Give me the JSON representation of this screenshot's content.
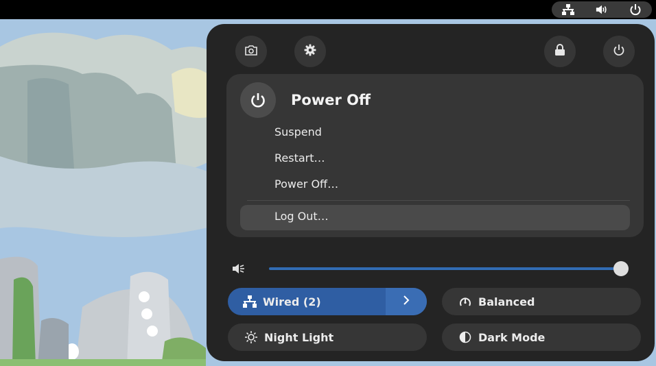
{
  "top_bar": {
    "indicators": [
      "network-wired-icon",
      "volume-icon",
      "power-icon"
    ]
  },
  "quick_settings": {
    "header_buttons": [
      "screenshot-icon",
      "settings-icon",
      "lock-icon",
      "power-icon"
    ],
    "power_menu": {
      "title": "Power Off",
      "items": [
        "Suspend",
        "Restart…",
        "Power Off…"
      ],
      "logout": "Log Out…"
    },
    "volume": {
      "level": 1.0
    },
    "toggles": {
      "wired": {
        "label": "Wired (2)",
        "active": true
      },
      "power_mode": {
        "label": "Balanced",
        "active": false
      },
      "night_light": {
        "label": "Night Light",
        "active": false
      },
      "dark_mode": {
        "label": "Dark Mode",
        "active": false
      }
    }
  },
  "colors": {
    "accent": "#3584e4",
    "menu_bg": "#242424",
    "card_bg": "#363636",
    "active_toggle": "#2f5ea3"
  }
}
